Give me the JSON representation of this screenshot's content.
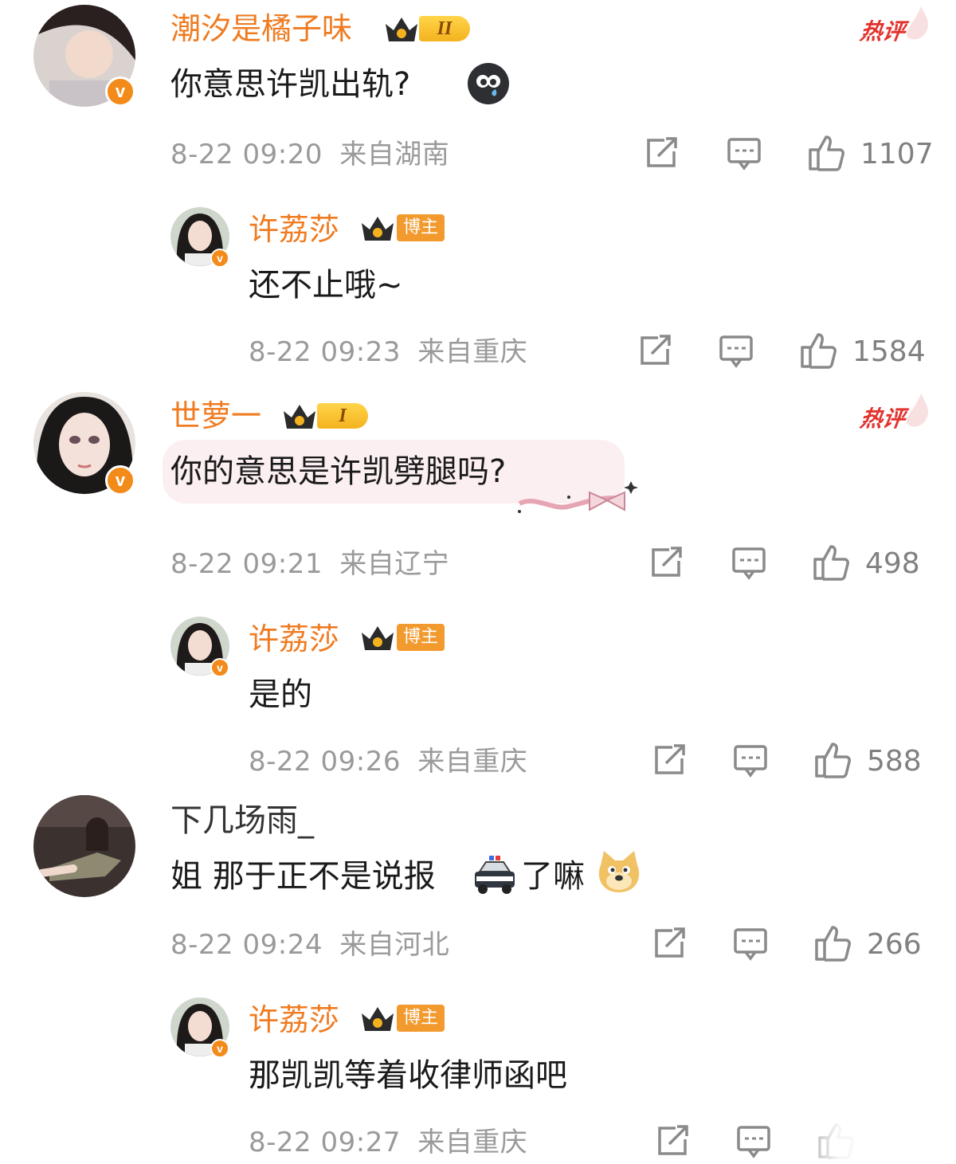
{
  "hot_label": "热评",
  "reply_badge": "博主",
  "comments": [
    {
      "user": "潮汐是橘子味",
      "level": "II",
      "text": "你意思许凯出轨?",
      "emoji": "crying-face-emoji",
      "time": "8-22 09:20",
      "location": "来自湖南",
      "likes": "1107",
      "hot": true
    },
    {
      "user": "许荔莎",
      "text": "还不止哦~",
      "time": "8-22 09:23",
      "location": "来自重庆",
      "likes": "1584"
    },
    {
      "user": "世萝一",
      "level": "I",
      "text": "你的意思是许凯劈腿吗?",
      "time": "8-22 09:21",
      "location": "来自辽宁",
      "likes": "498",
      "hot": true
    },
    {
      "user": "许荔莎",
      "text": "是的",
      "time": "8-22 09:26",
      "location": "来自重庆",
      "likes": "588"
    },
    {
      "user": "下几场雨_",
      "text_a": "姐 那于正不是说报",
      "text_b": "了嘛",
      "emoji_a": "police-car-emoji",
      "emoji_b": "doge-emoji",
      "time": "8-22 09:24",
      "location": "来自河北",
      "likes": "266"
    },
    {
      "user": "许荔莎",
      "text": "那凯凯等着收律师函吧",
      "time": "8-22 09:27",
      "location": "来自重庆"
    }
  ],
  "colors": {
    "username": "#ef7c22",
    "hot": "#e3322e",
    "meta": "#9a9a9a",
    "badge_orange": "#f28b1a"
  }
}
